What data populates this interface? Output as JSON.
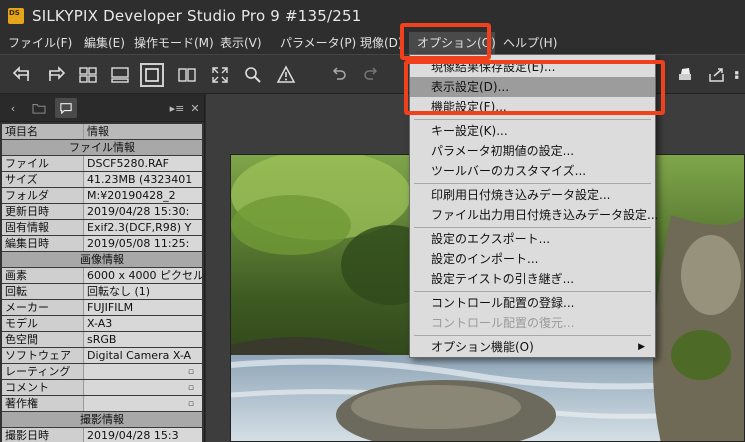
{
  "window": {
    "app_icon_text": "DS",
    "title": "SILKYPIX Developer Studio Pro 9    #135/251"
  },
  "menu": [
    {
      "label": "ファイル(F)"
    },
    {
      "label": "編集(E)"
    },
    {
      "label": "操作モード(M)"
    },
    {
      "label": "表示(V)"
    },
    {
      "label": "パラメータ(P)"
    },
    {
      "label": "現像(D)"
    },
    {
      "label": "オプション(O)"
    },
    {
      "label": "ヘルプ(H)"
    }
  ],
  "panel": {
    "header_key": "項目名",
    "header_value": "情報",
    "sections": {
      "file": "ファイル情報",
      "image": "画像情報",
      "shooting": "撮影情報"
    },
    "file_rows": [
      {
        "k": "ファイル",
        "v": "DSCF5280.RAF"
      },
      {
        "k": "サイズ",
        "v": "41.23MB (4323401"
      },
      {
        "k": "フォルダ",
        "v": "M:¥20190428_2"
      },
      {
        "k": "更新日時",
        "v": "2019/04/28 15:30:"
      },
      {
        "k": "固有情報",
        "v": "Exif2.3(DCF,R98) Y"
      },
      {
        "k": "編集日時",
        "v": "2019/05/08 11:25:"
      }
    ],
    "image_rows": [
      {
        "k": "画素",
        "v": "6000 x 4000 ピクセル"
      },
      {
        "k": "回転",
        "v": "回転なし (1)"
      },
      {
        "k": "メーカー",
        "v": "FUJIFILM"
      },
      {
        "k": "モデル",
        "v": "X-A3"
      },
      {
        "k": "色空間",
        "v": "sRGB"
      },
      {
        "k": "ソフトウェア",
        "v": "Digital Camera X-A"
      },
      {
        "k": "レーティング",
        "v": ""
      },
      {
        "k": "コメント",
        "v": ""
      },
      {
        "k": "著作権",
        "v": ""
      }
    ],
    "shooting_rows": [
      {
        "k": "撮影日時",
        "v": "2019/04/28 15:3"
      }
    ]
  },
  "options_menu": {
    "items": [
      {
        "label": "現像結果保存設定(E)..."
      },
      {
        "label": "表示設定(D)..."
      },
      {
        "label": "機能設定(F)..."
      },
      {
        "label": "キー設定(K)..."
      },
      {
        "label": "パラメータ初期値の設定..."
      },
      {
        "label": "ツールバーのカスタマイズ..."
      },
      {
        "label": "印刷用日付焼き込みデータ設定..."
      },
      {
        "label": "ファイル出力用日付焼き込みデータ設定..."
      },
      {
        "label": "設定のエクスポート..."
      },
      {
        "label": "設定のインポート..."
      },
      {
        "label": "設定テイストの引き継ぎ..."
      },
      {
        "label": "コントロール配置の登録..."
      },
      {
        "label": "コントロール配置の復元..."
      },
      {
        "label": "オプション機能(O)"
      }
    ],
    "highlighted_index": 1,
    "disabled_index": 12
  },
  "colors": {
    "highlight_box": "#f0401c",
    "menu_bg": "#dcdcdc",
    "menu_hover": "#9c9c9c"
  }
}
